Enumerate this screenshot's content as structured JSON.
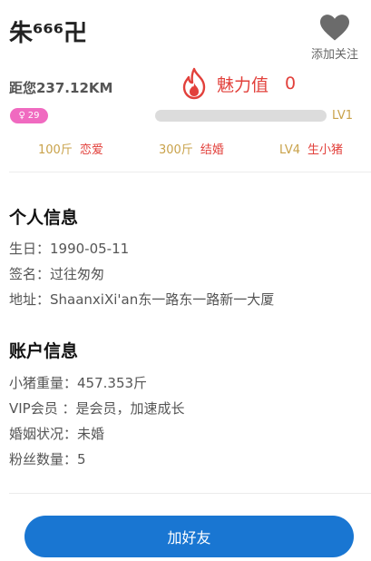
{
  "profile": {
    "name": "朱⁶⁶⁶卍",
    "follow_label": "添加关注",
    "distance": "距您237.12KM",
    "charm_label": "魅力值",
    "charm_value": "0",
    "badge_age": "29",
    "level": "LV1",
    "level_progress": 0
  },
  "milestones": [
    {
      "value": "100斤",
      "desc": "恋爱"
    },
    {
      "value": "300斤",
      "desc": "结婚"
    },
    {
      "value": "LV4",
      "desc": "生小猪"
    }
  ],
  "personal": {
    "title": "个人信息",
    "lines": [
      "生日：1990-05-11",
      "签名：过往匆匆",
      "地址：ShaanxiXi'an东一路东一路新一大厦"
    ]
  },
  "account": {
    "title": "账户信息",
    "lines": [
      "小猪重量：457.353斤",
      "VIP会员 ：是会员，加速成长",
      "婚姻状况：未婚",
      "粉丝数量：5"
    ]
  },
  "actions": {
    "add_friend": "加好友"
  },
  "colors": {
    "accent_red": "#e2403b",
    "gold": "#c9a24a",
    "primary_blue": "#1976d2",
    "badge_pink": "#f06ac0"
  }
}
